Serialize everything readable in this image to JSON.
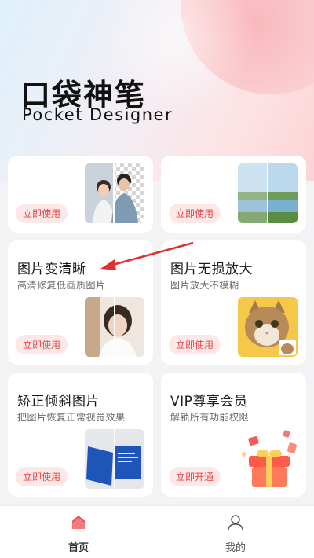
{
  "header": {
    "title": "口袋神笔",
    "subtitle": "Pocket Designer"
  },
  "cards": [
    {
      "title": "",
      "desc": "",
      "button": "立即使用",
      "thumb_icon": "couple-cutout-image"
    },
    {
      "title": "",
      "desc": "",
      "button": "立即使用",
      "thumb_icon": "landscape-compare-image"
    },
    {
      "title": "图片变清晰",
      "desc": "高清修复低画质图片",
      "button": "立即使用",
      "thumb_icon": "woman-portrait-image"
    },
    {
      "title": "图片无损放大",
      "desc": "图片放大不模糊",
      "button": "立即使用",
      "thumb_icon": "cat-image"
    },
    {
      "title": "矫正倾斜图片",
      "desc": "把图片恢复正常视觉效果",
      "button": "立即使用",
      "thumb_icon": "blue-card-image"
    },
    {
      "title": "VIP尊享会员",
      "desc": "解锁所有功能权限",
      "button": "立即开通",
      "thumb_icon": "gift-box-image"
    }
  ],
  "tabbar": {
    "home_label": "首页",
    "mine_label": "我的",
    "active_color": "#e8474a"
  },
  "colors": {
    "accent": "#e8474a",
    "button_bg": "#fde8e8"
  }
}
